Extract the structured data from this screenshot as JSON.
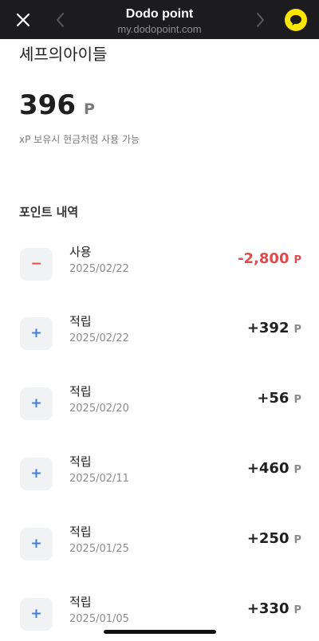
{
  "topbar": {
    "title": "Dodo point",
    "url": "my.dodopoint.com",
    "close_icon": "close-icon",
    "back_icon": "chevron-left-icon",
    "forward_icon": "chevron-right-icon",
    "kakao_icon": "kakao-talk-icon",
    "colors": {
      "bar": "#1c1c1e",
      "kakao": "#fee500"
    }
  },
  "store_name": "셰프의아이들",
  "balance": {
    "value": "396",
    "unit": "P"
  },
  "description": "xP 보유시 현금처럼 사용 가능",
  "history": {
    "title": "포인트 내역",
    "items": [
      {
        "type": "minus",
        "icon": "−",
        "label": "사용",
        "date": "2025/02/22",
        "amount": "-2,800",
        "unit": "P"
      },
      {
        "type": "plus",
        "icon": "+",
        "label": "적립",
        "date": "2025/02/22",
        "amount": "+392",
        "unit": "P"
      },
      {
        "type": "plus",
        "icon": "+",
        "label": "적립",
        "date": "2025/02/20",
        "amount": "+56",
        "unit": "P"
      },
      {
        "type": "plus",
        "icon": "+",
        "label": "적립",
        "date": "2025/02/11",
        "amount": "+460",
        "unit": "P"
      },
      {
        "type": "plus",
        "icon": "+",
        "label": "적립",
        "date": "2025/01/25",
        "amount": "+250",
        "unit": "P"
      },
      {
        "type": "plus",
        "icon": "+",
        "label": "적립",
        "date": "2025/01/05",
        "amount": "+330",
        "unit": "P"
      }
    ]
  },
  "colors": {
    "negative": "#e24b4b",
    "positive_icon": "#3f7ae0",
    "text": "#1f1f1f",
    "muted": "#8a8a8a"
  }
}
